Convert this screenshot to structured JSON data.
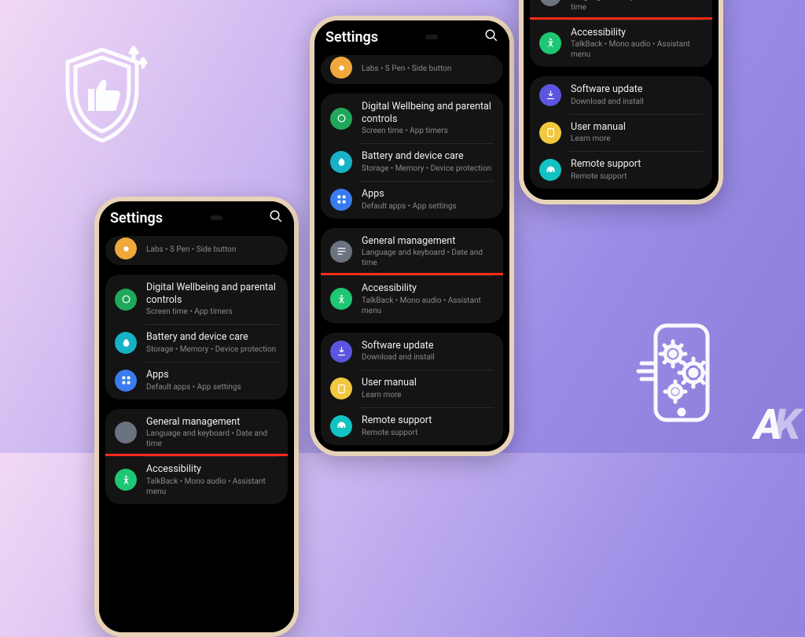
{
  "colors": {
    "orange": "#f0a83c",
    "green": "#1fa85a",
    "teal": "#17b2c5",
    "blue": "#3a7bf0",
    "grey": "#6b7280",
    "accGreen": "#1ec773",
    "purple": "#5b55e0",
    "yellow": "#f2c83f",
    "cyan": "#13c2c2"
  },
  "header": {
    "title": "Settings"
  },
  "rows": {
    "advanced": {
      "label": "",
      "sub": "Labs  •  S Pen  •  Side button"
    },
    "wellbeing": {
      "label": "Digital Wellbeing and parental controls",
      "sub": "Screen time  •  App timers"
    },
    "battery": {
      "label": "Battery and device care",
      "sub": "Storage  •  Memory  •  Device protection"
    },
    "apps": {
      "label": "Apps",
      "sub": "Default apps  •  App settings"
    },
    "general": {
      "label": "General management",
      "sub": "Language and keyboard  •  Date and time"
    },
    "access": {
      "label": "Accessibility",
      "sub": "TalkBack  •  Mono audio  •  Assistant menu"
    },
    "update": {
      "label": "Software update",
      "sub": "Download and install"
    },
    "manual": {
      "label": "User manual",
      "sub": "Learn more"
    },
    "remote": {
      "label": "Remote support",
      "sub": "Remote support"
    }
  }
}
